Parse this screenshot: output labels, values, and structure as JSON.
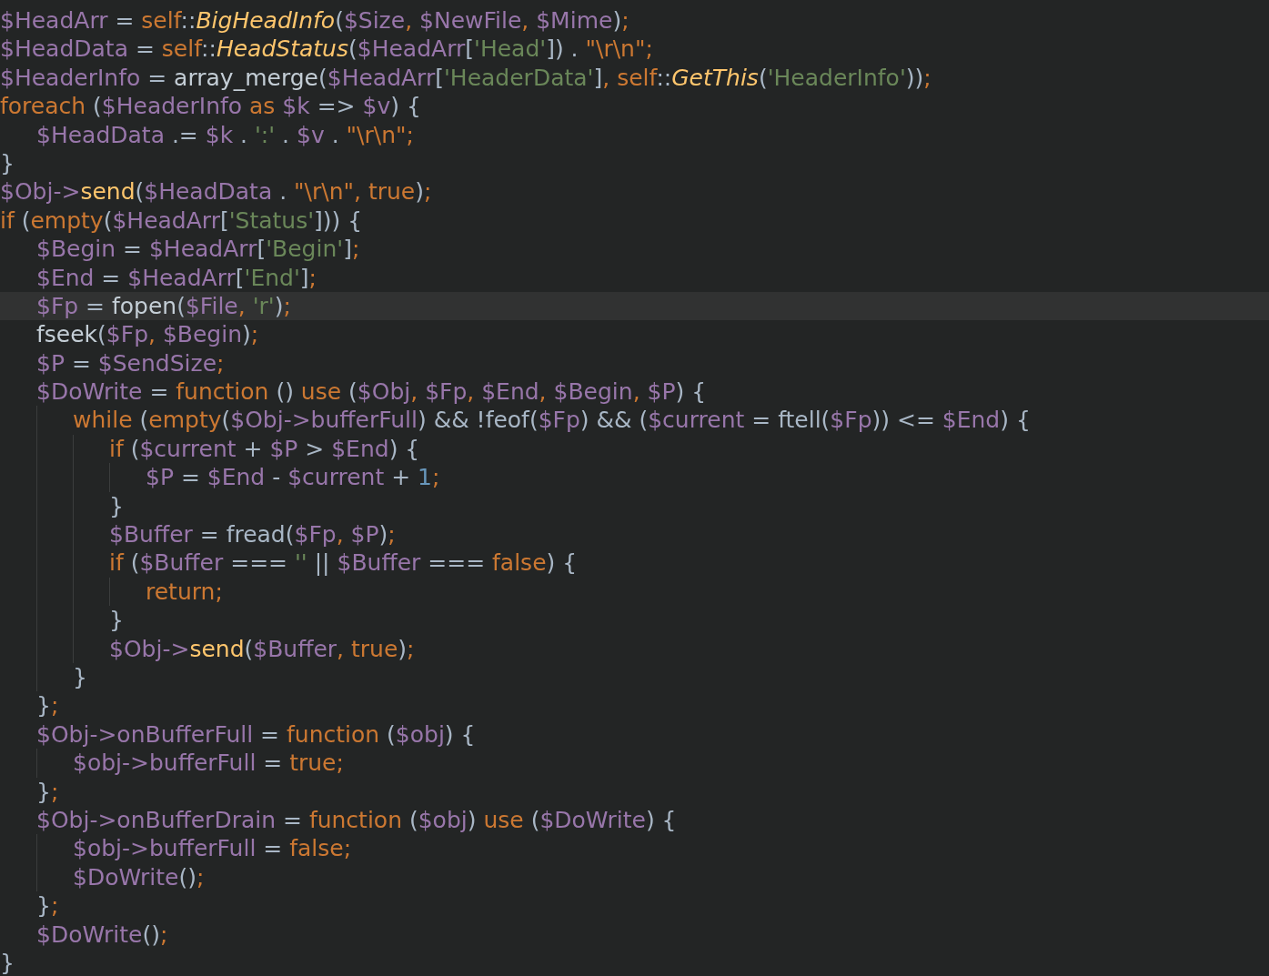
{
  "editor": {
    "lines": [
      {
        "current": false,
        "tokens": [
          {
            "kind": "var",
            "text": "$HeadArr"
          },
          {
            "kind": "plain",
            "text": " = "
          },
          {
            "kind": "keyword",
            "text": "self"
          },
          {
            "kind": "plain",
            "text": "::"
          },
          {
            "kind": "static_call",
            "text": "BigHeadInfo"
          },
          {
            "kind": "plain",
            "text": "("
          },
          {
            "kind": "var",
            "text": "$Size"
          },
          {
            "kind": "keyword",
            "text": ", "
          },
          {
            "kind": "var",
            "text": "$NewFile"
          },
          {
            "kind": "keyword",
            "text": ", "
          },
          {
            "kind": "var",
            "text": "$Mime"
          },
          {
            "kind": "plain",
            "text": ")"
          },
          {
            "kind": "keyword",
            "text": ";"
          }
        ]
      },
      {
        "current": false,
        "tokens": [
          {
            "kind": "var",
            "text": "$HeadData"
          },
          {
            "kind": "plain",
            "text": " = "
          },
          {
            "kind": "keyword",
            "text": "self"
          },
          {
            "kind": "plain",
            "text": "::"
          },
          {
            "kind": "static_call",
            "text": "HeadStatus"
          },
          {
            "kind": "plain",
            "text": "("
          },
          {
            "kind": "var",
            "text": "$HeadArr"
          },
          {
            "kind": "plain",
            "text": "["
          },
          {
            "kind": "string",
            "text": "'Head'"
          },
          {
            "kind": "plain",
            "text": "]) . "
          },
          {
            "kind": "keyword",
            "text": "\"\\r\\n\";"
          }
        ]
      },
      {
        "current": false,
        "tokens": [
          {
            "kind": "var",
            "text": "$HeaderInfo"
          },
          {
            "kind": "plain",
            "text": " = "
          },
          {
            "kind": "builtin",
            "text": "array_merge"
          },
          {
            "kind": "plain",
            "text": "("
          },
          {
            "kind": "var",
            "text": "$HeadArr"
          },
          {
            "kind": "plain",
            "text": "["
          },
          {
            "kind": "string",
            "text": "'HeaderData'"
          },
          {
            "kind": "plain",
            "text": "]"
          },
          {
            "kind": "keyword",
            "text": ", self"
          },
          {
            "kind": "plain",
            "text": "::"
          },
          {
            "kind": "static_call",
            "text": "GetThis"
          },
          {
            "kind": "plain",
            "text": "("
          },
          {
            "kind": "string",
            "text": "'HeaderInfo'"
          },
          {
            "kind": "plain",
            "text": "))"
          },
          {
            "kind": "keyword",
            "text": ";"
          }
        ]
      },
      {
        "current": false,
        "tokens": [
          {
            "kind": "keyword",
            "text": "foreach"
          },
          {
            "kind": "plain",
            "text": " ("
          },
          {
            "kind": "var",
            "text": "$HeaderInfo"
          },
          {
            "kind": "keyword",
            "text": " as "
          },
          {
            "kind": "var",
            "text": "$k"
          },
          {
            "kind": "plain",
            "text": " => "
          },
          {
            "kind": "var",
            "text": "$v"
          },
          {
            "kind": "plain",
            "text": ") {"
          }
        ],
        "children": [
          {
            "current": false,
            "tokens": [
              {
                "kind": "var",
                "text": "$HeadData"
              },
              {
                "kind": "plain",
                "text": " .= "
              },
              {
                "kind": "var",
                "text": "$k"
              },
              {
                "kind": "plain",
                "text": " . "
              },
              {
                "kind": "string",
                "text": "':'"
              },
              {
                "kind": "plain",
                "text": " . "
              },
              {
                "kind": "var",
                "text": "$v"
              },
              {
                "kind": "plain",
                "text": " . "
              },
              {
                "kind": "keyword",
                "text": "\"\\r\\n\";"
              }
            ]
          }
        ]
      },
      {
        "current": false,
        "tokens": [
          {
            "kind": "plain",
            "text": "}"
          }
        ]
      },
      {
        "current": false,
        "tokens": [
          {
            "kind": "var",
            "text": "$Obj->"
          },
          {
            "kind": "method",
            "text": "send"
          },
          {
            "kind": "plain",
            "text": "("
          },
          {
            "kind": "var",
            "text": "$HeadData"
          },
          {
            "kind": "plain",
            "text": " . "
          },
          {
            "kind": "keyword",
            "text": "\"\\r\\n\", true"
          },
          {
            "kind": "plain",
            "text": ")"
          },
          {
            "kind": "keyword",
            "text": ";"
          }
        ]
      },
      {
        "current": false,
        "tokens": [
          {
            "kind": "keyword",
            "text": "if"
          },
          {
            "kind": "plain",
            "text": " ("
          },
          {
            "kind": "keyword",
            "text": "empty"
          },
          {
            "kind": "plain",
            "text": "("
          },
          {
            "kind": "var",
            "text": "$HeadArr"
          },
          {
            "kind": "plain",
            "text": "["
          },
          {
            "kind": "string",
            "text": "'Status'"
          },
          {
            "kind": "plain",
            "text": "])) {"
          }
        ],
        "children": [
          {
            "current": false,
            "tokens": [
              {
                "kind": "var",
                "text": "$Begin"
              },
              {
                "kind": "plain",
                "text": " = "
              },
              {
                "kind": "var",
                "text": "$HeadArr"
              },
              {
                "kind": "plain",
                "text": "["
              },
              {
                "kind": "string",
                "text": "'Begin'"
              },
              {
                "kind": "plain",
                "text": "]"
              },
              {
                "kind": "keyword",
                "text": ";"
              }
            ]
          },
          {
            "current": false,
            "tokens": [
              {
                "kind": "var",
                "text": "$End"
              },
              {
                "kind": "plain",
                "text": " = "
              },
              {
                "kind": "var",
                "text": "$HeadArr"
              },
              {
                "kind": "plain",
                "text": "["
              },
              {
                "kind": "string",
                "text": "'End'"
              },
              {
                "kind": "plain",
                "text": "]"
              },
              {
                "kind": "keyword",
                "text": ";"
              }
            ]
          },
          {
            "current": true,
            "tokens": [
              {
                "kind": "var",
                "text": "$Fp"
              },
              {
                "kind": "plain",
                "text": " = "
              },
              {
                "kind": "builtin",
                "text": "fopen"
              },
              {
                "kind": "plain",
                "text": "("
              },
              {
                "kind": "var",
                "text": "$File"
              },
              {
                "kind": "keyword",
                "text": ", "
              },
              {
                "kind": "string",
                "text": "'r'"
              },
              {
                "kind": "plain",
                "text": ")"
              },
              {
                "kind": "keyword",
                "text": ";"
              }
            ]
          },
          {
            "current": false,
            "tokens": [
              {
                "kind": "builtin",
                "text": "fseek"
              },
              {
                "kind": "plain",
                "text": "("
              },
              {
                "kind": "var",
                "text": "$Fp"
              },
              {
                "kind": "keyword",
                "text": ", "
              },
              {
                "kind": "var",
                "text": "$Begin"
              },
              {
                "kind": "plain",
                "text": ")"
              },
              {
                "kind": "keyword",
                "text": ";"
              }
            ]
          },
          {
            "current": false,
            "tokens": [
              {
                "kind": "var",
                "text": "$P"
              },
              {
                "kind": "plain",
                "text": " = "
              },
              {
                "kind": "var",
                "text": "$SendSize"
              },
              {
                "kind": "keyword",
                "text": ";"
              }
            ]
          },
          {
            "current": false,
            "tokens": [
              {
                "kind": "var",
                "text": "$DoWrite"
              },
              {
                "kind": "plain",
                "text": " = "
              },
              {
                "kind": "keyword",
                "text": "function"
              },
              {
                "kind": "plain",
                "text": " () "
              },
              {
                "kind": "keyword",
                "text": "use"
              },
              {
                "kind": "plain",
                "text": " ("
              },
              {
                "kind": "var",
                "text": "$Obj"
              },
              {
                "kind": "keyword",
                "text": ", "
              },
              {
                "kind": "var",
                "text": "$Fp"
              },
              {
                "kind": "keyword",
                "text": ", "
              },
              {
                "kind": "var",
                "text": "$End"
              },
              {
                "kind": "keyword",
                "text": ", "
              },
              {
                "kind": "var",
                "text": "$Begin"
              },
              {
                "kind": "keyword",
                "text": ", "
              },
              {
                "kind": "var",
                "text": "$P"
              },
              {
                "kind": "plain",
                "text": ") {"
              }
            ],
            "children": [
              {
                "current": false,
                "tokens": [
                  {
                    "kind": "keyword",
                    "text": "while"
                  },
                  {
                    "kind": "plain",
                    "text": " ("
                  },
                  {
                    "kind": "keyword",
                    "text": "empty"
                  },
                  {
                    "kind": "plain",
                    "text": "("
                  },
                  {
                    "kind": "var",
                    "text": "$Obj->bufferFull"
                  },
                  {
                    "kind": "plain",
                    "text": ") && !feof("
                  },
                  {
                    "kind": "var",
                    "text": "$Fp"
                  },
                  {
                    "kind": "plain",
                    "text": ") && ("
                  },
                  {
                    "kind": "var",
                    "text": "$current"
                  },
                  {
                    "kind": "plain",
                    "text": " = ftell("
                  },
                  {
                    "kind": "var",
                    "text": "$Fp"
                  },
                  {
                    "kind": "plain",
                    "text": ")) <= "
                  },
                  {
                    "kind": "var",
                    "text": "$End"
                  },
                  {
                    "kind": "plain",
                    "text": ") {"
                  }
                ],
                "children": [
                  {
                    "current": false,
                    "tokens": [
                      {
                        "kind": "keyword",
                        "text": "if"
                      },
                      {
                        "kind": "plain",
                        "text": " ("
                      },
                      {
                        "kind": "var",
                        "text": "$current"
                      },
                      {
                        "kind": "plain",
                        "text": " + "
                      },
                      {
                        "kind": "var",
                        "text": "$P"
                      },
                      {
                        "kind": "plain",
                        "text": " > "
                      },
                      {
                        "kind": "var",
                        "text": "$End"
                      },
                      {
                        "kind": "plain",
                        "text": ") {"
                      }
                    ],
                    "children": [
                      {
                        "current": false,
                        "tokens": [
                          {
                            "kind": "var",
                            "text": "$P"
                          },
                          {
                            "kind": "plain",
                            "text": " = "
                          },
                          {
                            "kind": "var",
                            "text": "$End"
                          },
                          {
                            "kind": "plain",
                            "text": " - "
                          },
                          {
                            "kind": "var",
                            "text": "$current"
                          },
                          {
                            "kind": "plain",
                            "text": " + "
                          },
                          {
                            "kind": "number",
                            "text": "1"
                          },
                          {
                            "kind": "keyword",
                            "text": ";"
                          }
                        ]
                      }
                    ]
                  },
                  {
                    "current": false,
                    "tokens": [
                      {
                        "kind": "plain",
                        "text": "}"
                      }
                    ]
                  },
                  {
                    "current": false,
                    "tokens": [
                      {
                        "kind": "var",
                        "text": "$Buffer"
                      },
                      {
                        "kind": "plain",
                        "text": " = fread("
                      },
                      {
                        "kind": "var",
                        "text": "$Fp"
                      },
                      {
                        "kind": "keyword",
                        "text": ", "
                      },
                      {
                        "kind": "var",
                        "text": "$P"
                      },
                      {
                        "kind": "plain",
                        "text": ")"
                      },
                      {
                        "kind": "keyword",
                        "text": ";"
                      }
                    ]
                  },
                  {
                    "current": false,
                    "tokens": [
                      {
                        "kind": "keyword",
                        "text": "if"
                      },
                      {
                        "kind": "plain",
                        "text": " ("
                      },
                      {
                        "kind": "var",
                        "text": "$Buffer"
                      },
                      {
                        "kind": "plain",
                        "text": " === "
                      },
                      {
                        "kind": "string",
                        "text": "''"
                      },
                      {
                        "kind": "plain",
                        "text": " || "
                      },
                      {
                        "kind": "var",
                        "text": "$Buffer"
                      },
                      {
                        "kind": "plain",
                        "text": " === "
                      },
                      {
                        "kind": "keyword",
                        "text": "false"
                      },
                      {
                        "kind": "plain",
                        "text": ") {"
                      }
                    ],
                    "children": [
                      {
                        "current": false,
                        "tokens": [
                          {
                            "kind": "keyword",
                            "text": "return;"
                          }
                        ]
                      }
                    ]
                  },
                  {
                    "current": false,
                    "tokens": [
                      {
                        "kind": "plain",
                        "text": "}"
                      }
                    ]
                  },
                  {
                    "current": false,
                    "tokens": [
                      {
                        "kind": "var",
                        "text": "$Obj->"
                      },
                      {
                        "kind": "method",
                        "text": "send"
                      },
                      {
                        "kind": "plain",
                        "text": "("
                      },
                      {
                        "kind": "var",
                        "text": "$Buffer"
                      },
                      {
                        "kind": "keyword",
                        "text": ", true"
                      },
                      {
                        "kind": "plain",
                        "text": ")"
                      },
                      {
                        "kind": "keyword",
                        "text": ";"
                      }
                    ]
                  }
                ]
              },
              {
                "current": false,
                "tokens": [
                  {
                    "kind": "plain",
                    "text": "}"
                  }
                ]
              }
            ]
          },
          {
            "current": false,
            "tokens": [
              {
                "kind": "plain",
                "text": "}"
              },
              {
                "kind": "keyword",
                "text": ";"
              }
            ]
          },
          {
            "current": false,
            "tokens": [
              {
                "kind": "var",
                "text": "$Obj->onBufferFull"
              },
              {
                "kind": "plain",
                "text": " = "
              },
              {
                "kind": "keyword",
                "text": "function"
              },
              {
                "kind": "plain",
                "text": " ("
              },
              {
                "kind": "var",
                "text": "$obj"
              },
              {
                "kind": "plain",
                "text": ") {"
              }
            ],
            "children": [
              {
                "current": false,
                "tokens": [
                  {
                    "kind": "var",
                    "text": "$obj->bufferFull"
                  },
                  {
                    "kind": "plain",
                    "text": " = "
                  },
                  {
                    "kind": "keyword",
                    "text": "true;"
                  }
                ]
              }
            ]
          },
          {
            "current": false,
            "tokens": [
              {
                "kind": "plain",
                "text": "}"
              },
              {
                "kind": "keyword",
                "text": ";"
              }
            ]
          },
          {
            "current": false,
            "tokens": [
              {
                "kind": "var",
                "text": "$Obj->onBufferDrain"
              },
              {
                "kind": "plain",
                "text": " = "
              },
              {
                "kind": "keyword",
                "text": "function"
              },
              {
                "kind": "plain",
                "text": " ("
              },
              {
                "kind": "var",
                "text": "$obj"
              },
              {
                "kind": "plain",
                "text": ") "
              },
              {
                "kind": "keyword",
                "text": "use"
              },
              {
                "kind": "plain",
                "text": " ("
              },
              {
                "kind": "var",
                "text": "$DoWrite"
              },
              {
                "kind": "plain",
                "text": ") {"
              }
            ],
            "children": [
              {
                "current": false,
                "tokens": [
                  {
                    "kind": "var",
                    "text": "$obj->bufferFull"
                  },
                  {
                    "kind": "plain",
                    "text": " = "
                  },
                  {
                    "kind": "keyword",
                    "text": "false;"
                  }
                ]
              },
              {
                "current": false,
                "tokens": [
                  {
                    "kind": "var",
                    "text": "$DoWrite"
                  },
                  {
                    "kind": "plain",
                    "text": "()"
                  },
                  {
                    "kind": "keyword",
                    "text": ";"
                  }
                ]
              }
            ]
          },
          {
            "current": false,
            "tokens": [
              {
                "kind": "plain",
                "text": "}"
              },
              {
                "kind": "keyword",
                "text": ";"
              }
            ]
          },
          {
            "current": false,
            "tokens": [
              {
                "kind": "var",
                "text": "$DoWrite"
              },
              {
                "kind": "plain",
                "text": "()"
              },
              {
                "kind": "keyword",
                "text": ";"
              }
            ]
          }
        ]
      },
      {
        "current": false,
        "tokens": [
          {
            "kind": "plain",
            "text": "}"
          }
        ]
      }
    ]
  }
}
